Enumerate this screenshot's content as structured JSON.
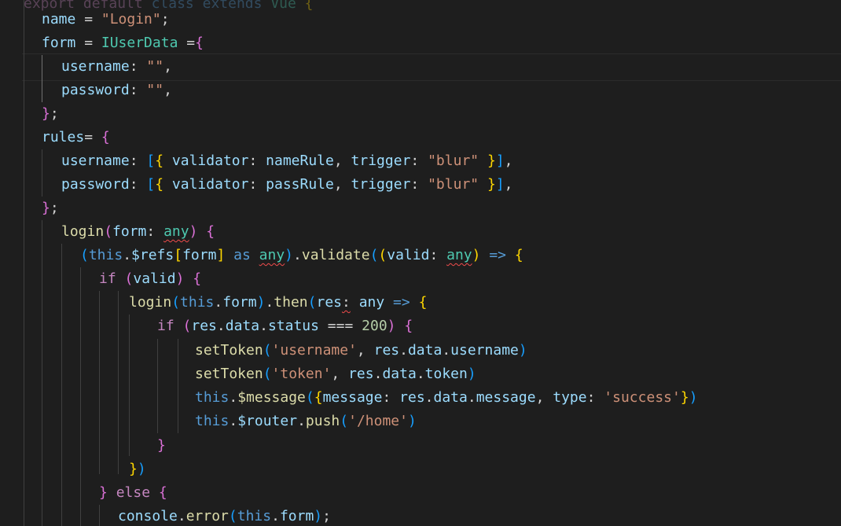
{
  "editor": {
    "lines": [
      {
        "tokens": [
          {
            "t": "export",
            "c": "tok-ctrl faded"
          },
          {
            "t": " ",
            "c": ""
          },
          {
            "t": "default",
            "c": "tok-ctrl faded"
          },
          {
            "t": " ",
            "c": ""
          },
          {
            "t": "class",
            "c": "tok-kw faded"
          },
          {
            "t": " ",
            "c": ""
          },
          {
            "t": "extends",
            "c": "tok-kw faded"
          },
          {
            "t": " ",
            "c": ""
          },
          {
            "t": "Vue",
            "c": "tok-type faded"
          },
          {
            "t": " ",
            "c": ""
          },
          {
            "t": "{",
            "c": "b1 faded"
          }
        ]
      },
      {
        "tokens": [
          {
            "t": "name",
            "c": "tok-var"
          },
          {
            "t": " = ",
            "c": "tok-op"
          },
          {
            "t": "\"Login\"",
            "c": "tok-str"
          },
          {
            "t": ";",
            "c": "tok-op"
          }
        ]
      },
      {
        "tokens": [
          {
            "t": "form",
            "c": "tok-var"
          },
          {
            "t": " = ",
            "c": "tok-op"
          },
          {
            "t": "IUserData",
            "c": "tok-type"
          },
          {
            "t": " =",
            "c": "tok-op"
          },
          {
            "t": "{",
            "c": "b2"
          }
        ]
      },
      {
        "tokens": [
          {
            "t": "username",
            "c": "tok-var"
          },
          {
            "t": ": ",
            "c": "tok-op"
          },
          {
            "t": "\"\"",
            "c": "tok-str"
          },
          {
            "t": ",",
            "c": "tok-op"
          }
        ]
      },
      {
        "tokens": [
          {
            "t": "password",
            "c": "tok-var"
          },
          {
            "t": ": ",
            "c": "tok-op"
          },
          {
            "t": "\"\"",
            "c": "tok-str"
          },
          {
            "t": ",",
            "c": "tok-op"
          }
        ]
      },
      {
        "tokens": [
          {
            "t": "}",
            "c": "b2"
          },
          {
            "t": ";",
            "c": "tok-op"
          }
        ]
      },
      {
        "tokens": [
          {
            "t": "rules",
            "c": "tok-var"
          },
          {
            "t": "= ",
            "c": "tok-op"
          },
          {
            "t": "{",
            "c": "b2"
          }
        ]
      },
      {
        "tokens": [
          {
            "t": "username",
            "c": "tok-var"
          },
          {
            "t": ": ",
            "c": "tok-op"
          },
          {
            "t": "[",
            "c": "b3"
          },
          {
            "t": "{",
            "c": "b1"
          },
          {
            "t": " ",
            "c": ""
          },
          {
            "t": "validator",
            "c": "tok-var"
          },
          {
            "t": ": ",
            "c": "tok-op"
          },
          {
            "t": "nameRule",
            "c": "tok-var"
          },
          {
            "t": ", ",
            "c": "tok-op"
          },
          {
            "t": "trigger",
            "c": "tok-var"
          },
          {
            "t": ": ",
            "c": "tok-op"
          },
          {
            "t": "\"blur\"",
            "c": "tok-str"
          },
          {
            "t": " ",
            "c": ""
          },
          {
            "t": "}",
            "c": "b1"
          },
          {
            "t": "]",
            "c": "b3"
          },
          {
            "t": ",",
            "c": "tok-op"
          }
        ]
      },
      {
        "tokens": [
          {
            "t": "password",
            "c": "tok-var"
          },
          {
            "t": ": ",
            "c": "tok-op"
          },
          {
            "t": "[",
            "c": "b3"
          },
          {
            "t": "{",
            "c": "b1"
          },
          {
            "t": " ",
            "c": ""
          },
          {
            "t": "validator",
            "c": "tok-var"
          },
          {
            "t": ": ",
            "c": "tok-op"
          },
          {
            "t": "passRule",
            "c": "tok-var"
          },
          {
            "t": ", ",
            "c": "tok-op"
          },
          {
            "t": "trigger",
            "c": "tok-var"
          },
          {
            "t": ": ",
            "c": "tok-op"
          },
          {
            "t": "\"blur\"",
            "c": "tok-str"
          },
          {
            "t": " ",
            "c": ""
          },
          {
            "t": "}",
            "c": "b1"
          },
          {
            "t": "]",
            "c": "b3"
          },
          {
            "t": ",",
            "c": "tok-op"
          }
        ]
      },
      {
        "tokens": [
          {
            "t": "}",
            "c": "b2"
          },
          {
            "t": ";",
            "c": "tok-op"
          }
        ]
      },
      {
        "tokens": [
          {
            "t": "login",
            "c": "tok-fn"
          },
          {
            "t": "(",
            "c": "b2"
          },
          {
            "t": "form",
            "c": "tok-var"
          },
          {
            "t": ": ",
            "c": "tok-op"
          },
          {
            "t": "any",
            "c": "tok-type squig"
          },
          {
            "t": ")",
            "c": "b2"
          },
          {
            "t": " ",
            "c": ""
          },
          {
            "t": "{",
            "c": "b2"
          }
        ]
      },
      {
        "tokens": [
          {
            "t": "(",
            "c": "b3"
          },
          {
            "t": "this",
            "c": "tok-kw"
          },
          {
            "t": ".",
            "c": "tok-op"
          },
          {
            "t": "$refs",
            "c": "tok-var"
          },
          {
            "t": "[",
            "c": "b1"
          },
          {
            "t": "form",
            "c": "tok-var"
          },
          {
            "t": "]",
            "c": "b1"
          },
          {
            "t": " ",
            "c": ""
          },
          {
            "t": "as",
            "c": "tok-kw"
          },
          {
            "t": " ",
            "c": ""
          },
          {
            "t": "any",
            "c": "tok-type squig"
          },
          {
            "t": ")",
            "c": "b3"
          },
          {
            "t": ".",
            "c": "tok-op"
          },
          {
            "t": "validate",
            "c": "tok-fn"
          },
          {
            "t": "(",
            "c": "b3"
          },
          {
            "t": "(",
            "c": "b1"
          },
          {
            "t": "valid",
            "c": "tok-var"
          },
          {
            "t": ": ",
            "c": "tok-op"
          },
          {
            "t": "any",
            "c": "tok-type squig"
          },
          {
            "t": ")",
            "c": "b1"
          },
          {
            "t": " ",
            "c": ""
          },
          {
            "t": "=>",
            "c": "tok-kw"
          },
          {
            "t": " ",
            "c": ""
          },
          {
            "t": "{",
            "c": "b1"
          }
        ]
      },
      {
        "tokens": [
          {
            "t": "if",
            "c": "tok-ctrl"
          },
          {
            "t": " ",
            "c": ""
          },
          {
            "t": "(",
            "c": "b2"
          },
          {
            "t": "valid",
            "c": "tok-var"
          },
          {
            "t": ")",
            "c": "b2"
          },
          {
            "t": " ",
            "c": ""
          },
          {
            "t": "{",
            "c": "b2"
          }
        ]
      },
      {
        "tokens": [
          {
            "t": "login",
            "c": "tok-fn"
          },
          {
            "t": "(",
            "c": "b3"
          },
          {
            "t": "this",
            "c": "tok-kw"
          },
          {
            "t": ".",
            "c": "tok-op"
          },
          {
            "t": "form",
            "c": "tok-var"
          },
          {
            "t": ")",
            "c": "b3"
          },
          {
            "t": ".",
            "c": "tok-op"
          },
          {
            "t": "then",
            "c": "tok-fn"
          },
          {
            "t": "(",
            "c": "b3"
          },
          {
            "t": "res",
            "c": "tok-var"
          },
          {
            "t": ":",
            "c": "tok-op squig"
          },
          {
            "t": " ",
            "c": ""
          },
          {
            "t": "any",
            "c": "tok-var"
          },
          {
            "t": " ",
            "c": ""
          },
          {
            "t": "=>",
            "c": "tok-kw"
          },
          {
            "t": " ",
            "c": ""
          },
          {
            "t": "{",
            "c": "b1"
          }
        ]
      },
      {
        "tokens": [
          {
            "t": "if",
            "c": "tok-ctrl"
          },
          {
            "t": " ",
            "c": ""
          },
          {
            "t": "(",
            "c": "b2"
          },
          {
            "t": "res",
            "c": "tok-var"
          },
          {
            "t": ".",
            "c": "tok-op"
          },
          {
            "t": "data",
            "c": "tok-var"
          },
          {
            "t": ".",
            "c": "tok-op"
          },
          {
            "t": "status",
            "c": "tok-var"
          },
          {
            "t": " === ",
            "c": "tok-op"
          },
          {
            "t": "200",
            "c": "tok-num"
          },
          {
            "t": ")",
            "c": "b2"
          },
          {
            "t": " ",
            "c": ""
          },
          {
            "t": "{",
            "c": "b2"
          }
        ]
      },
      {
        "tokens": [
          {
            "t": "setToken",
            "c": "tok-fn"
          },
          {
            "t": "(",
            "c": "b3"
          },
          {
            "t": "'username'",
            "c": "tok-str"
          },
          {
            "t": ", ",
            "c": "tok-op"
          },
          {
            "t": "res",
            "c": "tok-var"
          },
          {
            "t": ".",
            "c": "tok-op"
          },
          {
            "t": "data",
            "c": "tok-var"
          },
          {
            "t": ".",
            "c": "tok-op"
          },
          {
            "t": "username",
            "c": "tok-var"
          },
          {
            "t": ")",
            "c": "b3"
          }
        ]
      },
      {
        "tokens": [
          {
            "t": "setToken",
            "c": "tok-fn"
          },
          {
            "t": "(",
            "c": "b3"
          },
          {
            "t": "'token'",
            "c": "tok-str"
          },
          {
            "t": ", ",
            "c": "tok-op"
          },
          {
            "t": "res",
            "c": "tok-var"
          },
          {
            "t": ".",
            "c": "tok-op"
          },
          {
            "t": "data",
            "c": "tok-var"
          },
          {
            "t": ".",
            "c": "tok-op"
          },
          {
            "t": "token",
            "c": "tok-var"
          },
          {
            "t": ")",
            "c": "b3"
          }
        ]
      },
      {
        "tokens": [
          {
            "t": "this",
            "c": "tok-kw"
          },
          {
            "t": ".",
            "c": "tok-op"
          },
          {
            "t": "$message",
            "c": "tok-fn"
          },
          {
            "t": "(",
            "c": "b3"
          },
          {
            "t": "{",
            "c": "b1"
          },
          {
            "t": "message",
            "c": "tok-var"
          },
          {
            "t": ": ",
            "c": "tok-op"
          },
          {
            "t": "res",
            "c": "tok-var"
          },
          {
            "t": ".",
            "c": "tok-op"
          },
          {
            "t": "data",
            "c": "tok-var"
          },
          {
            "t": ".",
            "c": "tok-op"
          },
          {
            "t": "message",
            "c": "tok-var"
          },
          {
            "t": ", ",
            "c": "tok-op"
          },
          {
            "t": "type",
            "c": "tok-var"
          },
          {
            "t": ": ",
            "c": "tok-op"
          },
          {
            "t": "'success'",
            "c": "tok-str"
          },
          {
            "t": "}",
            "c": "b1"
          },
          {
            "t": ")",
            "c": "b3"
          }
        ]
      },
      {
        "tokens": [
          {
            "t": "this",
            "c": "tok-kw"
          },
          {
            "t": ".",
            "c": "tok-op"
          },
          {
            "t": "$router",
            "c": "tok-var"
          },
          {
            "t": ".",
            "c": "tok-op"
          },
          {
            "t": "push",
            "c": "tok-fn"
          },
          {
            "t": "(",
            "c": "b3"
          },
          {
            "t": "'/home'",
            "c": "tok-str"
          },
          {
            "t": ")",
            "c": "b3"
          }
        ]
      },
      {
        "tokens": [
          {
            "t": "}",
            "c": "b2"
          }
        ]
      },
      {
        "tokens": [
          {
            "t": "}",
            "c": "b1"
          },
          {
            "t": ")",
            "c": "b3"
          }
        ]
      },
      {
        "tokens": [
          {
            "t": "}",
            "c": "b2"
          },
          {
            "t": " ",
            "c": ""
          },
          {
            "t": "else",
            "c": "tok-ctrl"
          },
          {
            "t": " ",
            "c": ""
          },
          {
            "t": "{",
            "c": "b2"
          }
        ]
      },
      {
        "tokens": [
          {
            "t": "console",
            "c": "tok-var"
          },
          {
            "t": ".",
            "c": "tok-op"
          },
          {
            "t": "error",
            "c": "tok-fn"
          },
          {
            "t": "(",
            "c": "b3"
          },
          {
            "t": "this",
            "c": "tok-kw"
          },
          {
            "t": ".",
            "c": "tok-op"
          },
          {
            "t": "form",
            "c": "tok-var"
          },
          {
            "t": ")",
            "c": "b3"
          },
          {
            "t": ";",
            "c": "tok-op"
          }
        ]
      }
    ]
  }
}
